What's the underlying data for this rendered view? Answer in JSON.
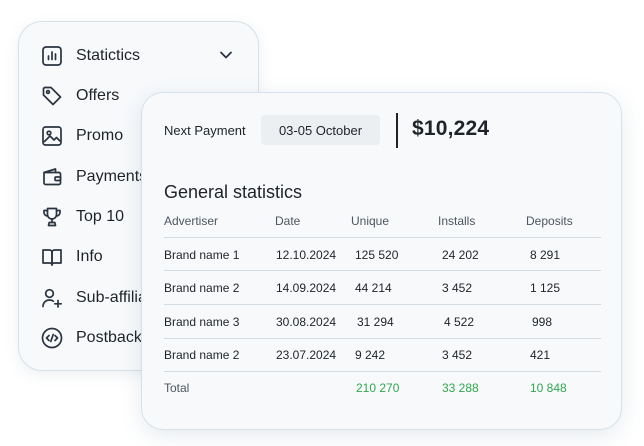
{
  "sidebar": {
    "items": [
      {
        "label": "Statictics",
        "icon": "bar-chart-icon"
      },
      {
        "label": "Offers",
        "icon": "tag-icon"
      },
      {
        "label": "Promo",
        "icon": "image-icon"
      },
      {
        "label": "Payments",
        "icon": "wallet-icon"
      },
      {
        "label": "Top 10",
        "icon": "trophy-icon"
      },
      {
        "label": "Info",
        "icon": "book-icon"
      },
      {
        "label": "Sub-affiliates",
        "icon": "user-add-icon"
      },
      {
        "label": "Postback",
        "icon": "code-icon"
      }
    ],
    "expand_icon": "chevron-down-icon"
  },
  "panel": {
    "next_payment_label": "Next Payment",
    "next_payment_date": "03-05 October",
    "amount": "$10,224",
    "section_title": "General statistics",
    "columns": [
      "Advertiser",
      "Date",
      "Unique",
      "Installs",
      "Deposits"
    ],
    "rows": [
      [
        "Brand name 1",
        "12.10.2024",
        "125 520",
        "24 202",
        "8 291"
      ],
      [
        "Brand name 2",
        "14.09.2024",
        "44 214",
        "3 452",
        "1 125"
      ],
      [
        "Brand name 3",
        "30.08.2024",
        "31 294",
        "4 522",
        "998"
      ],
      [
        "Brand name 2",
        "23.07.2024",
        "9 242",
        "3 452",
        "421"
      ]
    ],
    "total": {
      "label": "Total",
      "unique": "210 270",
      "installs": "33 288",
      "deposits": "10 848"
    }
  },
  "colors": {
    "total_green": "#2fa84f",
    "border": "#d5e1ea",
    "card_bg": "#f7f9fb"
  }
}
